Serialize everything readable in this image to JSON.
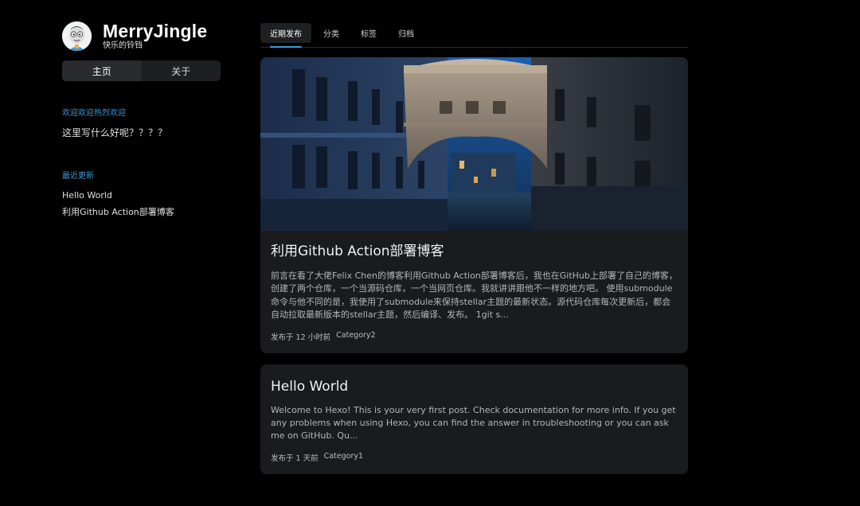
{
  "site": {
    "title": "MerryJingle",
    "subtitle": "快乐的铃铛"
  },
  "menu": {
    "items": [
      {
        "label": "主页",
        "active": true
      },
      {
        "label": "关于",
        "active": false
      }
    ]
  },
  "widgets": {
    "welcome": {
      "title": "欢迎欢迎热烈欢迎",
      "body": "这里写什么好呢？？？？"
    },
    "recent": {
      "title": "最近更新",
      "items": [
        "Hello World",
        "利用Github Action部署博客"
      ]
    }
  },
  "tabs": [
    {
      "label": "近期发布",
      "active": true
    },
    {
      "label": "分类",
      "active": false
    },
    {
      "label": "标签",
      "active": false
    },
    {
      "label": "归档",
      "active": false
    }
  ],
  "posts": [
    {
      "title": "利用Github Action部署博客",
      "excerpt": "前言在看了大佬Felix Chen的博客利用Github Action部署博客后，我也在GitHub上部署了自己的博客，创建了两个仓库，一个当源码仓库，一个当网页仓库。我就讲讲跟他不一样的地方吧。 使用submodule命令与他不同的是，我使用了submodule来保持stellar主题的最新状态。源代码仓库每次更新后，都会自动拉取最新版本的stellar主题，然后编译、发布。 1git s...",
      "meta_prefix": "发布于 12 小时前",
      "category": "Category2"
    },
    {
      "title": "Hello World",
      "excerpt": "Welcome to Hexo! This is your very first post. Check documentation for more info. If you get any problems when using Hexo, you can find the answer in troubleshooting or you can ask me on GitHub. Qu...",
      "meta_prefix": "发布于 1 天前",
      "category": "Category1"
    }
  ],
  "colors": {
    "background": "#000000",
    "card": "#1a1b1d",
    "accent": "#3b9bd9"
  }
}
